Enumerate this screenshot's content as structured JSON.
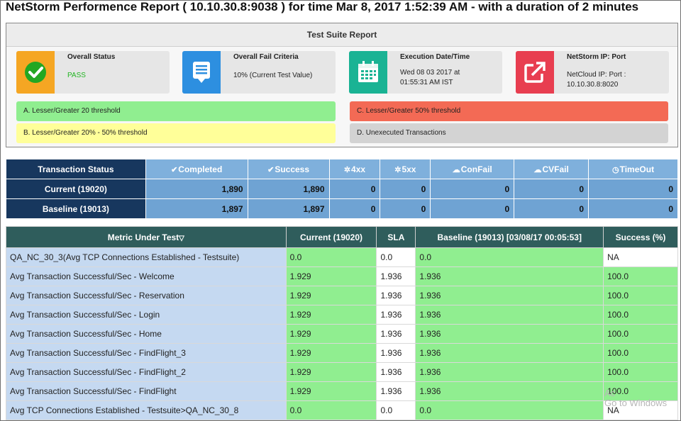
{
  "title": "NetStorm Performence Report ( 10.10.30.8:9038 ) for time Mar 8, 2017 1:52:39 AM - with a duration of 2 minutes",
  "suite": {
    "heading": "Test Suite Report",
    "cards": [
      {
        "label": "Overall Status",
        "lines": [
          "PASS"
        ],
        "icon": "check-circle-icon",
        "color": "#f5a623"
      },
      {
        "label": "Overall Fail Criteria",
        "lines": [
          "10% (Current Test Value)"
        ],
        "icon": "document-icon",
        "color": "#2d8fe0"
      },
      {
        "label": "Execution Date/Time",
        "lines": [
          "Wed 08 03 2017 at",
          "01:55:31 AM IST"
        ],
        "icon": "calendar-icon",
        "color": "#1ab394"
      },
      {
        "label": "NetStorm IP: Port",
        "lines": [
          "NetCloud IP: Port :",
          "10.10.30.8:8020"
        ],
        "icon": "external-link-icon",
        "color": "#e83e50"
      }
    ],
    "legend": [
      {
        "text": "A. Lesser/Greater 20 threshold",
        "color": "#90ee90"
      },
      {
        "text": "B. Lesser/Greater 20% - 50% threshold",
        "color": "#ffff99"
      },
      {
        "text": "C. Lesser/Greater 50% threshold",
        "color": "#f36a55"
      },
      {
        "text": "D. Unexecuted Transactions",
        "color": "#d3d3d3"
      }
    ]
  },
  "transaction_status": {
    "headers": [
      "Transaction Status",
      "Completed",
      "Success",
      "4xx",
      "5xx",
      "ConFail",
      "CVFail",
      "TimeOut"
    ],
    "header_icons": [
      "",
      "check-circle-icon",
      "check-circle-icon",
      "bug-icon",
      "bug-icon",
      "cloud-icon",
      "cloud-icon",
      "clock-icon"
    ],
    "rows": [
      {
        "label": "Current (19020)",
        "values": [
          "1,890",
          "1,890",
          "0",
          "0",
          "0",
          "0",
          "0"
        ]
      },
      {
        "label": "Baseline (19013)",
        "values": [
          "1,897",
          "1,897",
          "0",
          "0",
          "0",
          "0",
          "0"
        ]
      }
    ]
  },
  "metrics": {
    "headers": [
      "Metric Under Test",
      "Current (19020)",
      "SLA",
      "Baseline (19013) [03/08/17 00:05:53]",
      "Success (%)"
    ],
    "sort_indicator": "▽",
    "rows": [
      {
        "name": "QA_NC_30_3(Avg TCP Connections Established - Testsuite)",
        "current": "0.0",
        "sla": "0.0",
        "baseline": "0.0",
        "success": "NA"
      },
      {
        "name": "Avg Transaction Successful/Sec - Welcome",
        "current": "1.929",
        "sla": "1.936",
        "baseline": "1.936",
        "success": "100.0"
      },
      {
        "name": "Avg Transaction Successful/Sec - Reservation",
        "current": "1.929",
        "sla": "1.936",
        "baseline": "1.936",
        "success": "100.0"
      },
      {
        "name": "Avg Transaction Successful/Sec - Login",
        "current": "1.929",
        "sla": "1.936",
        "baseline": "1.936",
        "success": "100.0"
      },
      {
        "name": "Avg Transaction Successful/Sec - Home",
        "current": "1.929",
        "sla": "1.936",
        "baseline": "1.936",
        "success": "100.0"
      },
      {
        "name": "Avg Transaction Successful/Sec - FindFlight_3",
        "current": "1.929",
        "sla": "1.936",
        "baseline": "1.936",
        "success": "100.0"
      },
      {
        "name": "Avg Transaction Successful/Sec - FindFlight_2",
        "current": "1.929",
        "sla": "1.936",
        "baseline": "1.936",
        "success": "100.0"
      },
      {
        "name": "Avg Transaction Successful/Sec - FindFlight",
        "current": "1.929",
        "sla": "1.936",
        "baseline": "1.936",
        "success": "100.0"
      },
      {
        "name": "Avg TCP Connections Established - Testsuite>QA_NC_30_8",
        "current": "0.0",
        "sla": "0.0",
        "baseline": "0.0",
        "success": "NA"
      }
    ]
  },
  "watermark": {
    "line1": "Ac",
    "line2": "Go to Windows"
  }
}
